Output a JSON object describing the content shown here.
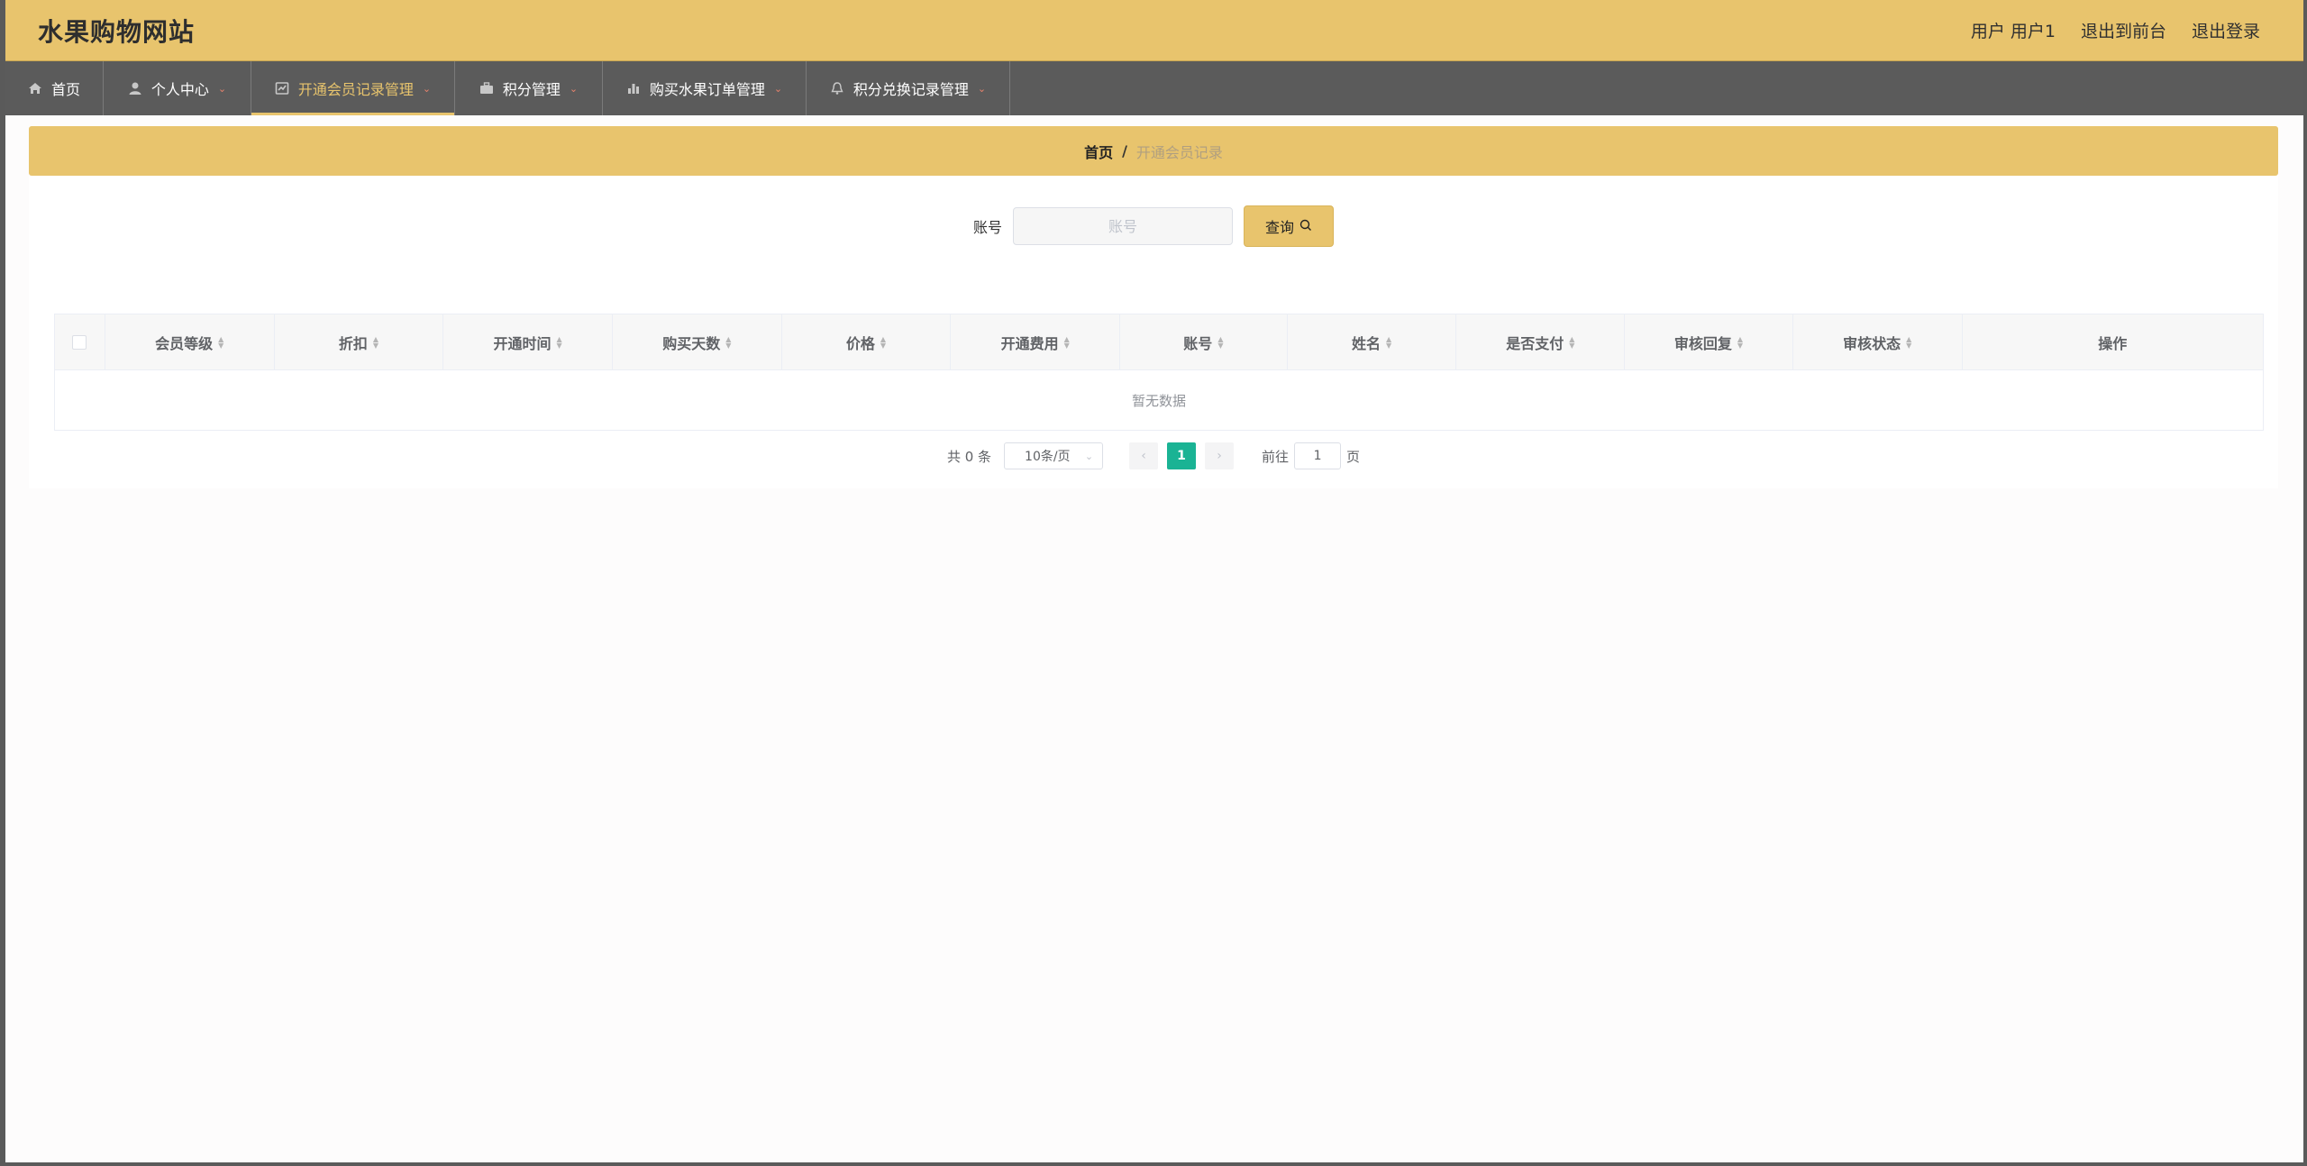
{
  "header": {
    "site_title": "水果购物网站",
    "user_label": "用户 用户1",
    "back_to_front": "退出到前台",
    "logout": "退出登录"
  },
  "nav": {
    "items": [
      {
        "label": "首页",
        "icon": "home-icon",
        "has_dropdown": false,
        "active": false
      },
      {
        "label": "个人中心",
        "icon": "user-icon",
        "has_dropdown": true,
        "active": false
      },
      {
        "label": "开通会员记录管理",
        "icon": "record-icon",
        "has_dropdown": true,
        "active": true
      },
      {
        "label": "积分管理",
        "icon": "briefcase-icon",
        "has_dropdown": true,
        "active": false
      },
      {
        "label": "购买水果订单管理",
        "icon": "chart-icon",
        "has_dropdown": true,
        "active": false
      },
      {
        "label": "积分兑换记录管理",
        "icon": "bell-icon",
        "has_dropdown": true,
        "active": false
      }
    ]
  },
  "breadcrumb": {
    "home": "首页",
    "separator": "/",
    "current": "开通会员记录"
  },
  "search": {
    "label": "账号",
    "placeholder": "账号",
    "value": "",
    "button": "查询"
  },
  "table": {
    "columns": [
      "会员等级",
      "折扣",
      "开通时间",
      "购买天数",
      "价格",
      "开通费用",
      "账号",
      "姓名",
      "是否支付",
      "审核回复",
      "审核状态",
      "操作"
    ],
    "empty_text": "暂无数据",
    "rows": []
  },
  "pagination": {
    "total": "共 0 条",
    "page_size": "10条/页",
    "current_page": "1",
    "goto_prefix": "前往",
    "goto_value": "1",
    "goto_suffix": "页"
  },
  "colors": {
    "accent": "#e8c46d",
    "nav_bg": "#5b5b5b",
    "pager_active": "#1ab394"
  }
}
